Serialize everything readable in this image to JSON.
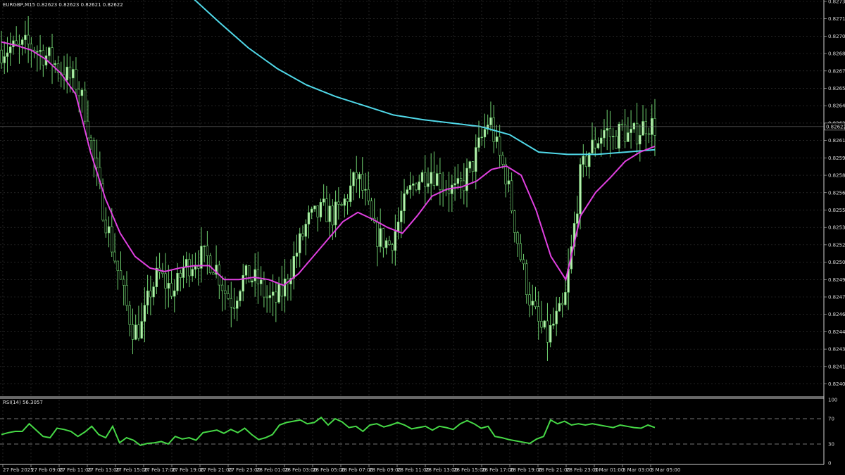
{
  "window": {
    "header": "EURGBP,M15  0.82623 0.82623 0.82621 0.82622",
    "current_price_label": "0.82622"
  },
  "colors": {
    "background": "#000000",
    "grid": "#3a3a3a",
    "bull_candle": "#b8f0b0",
    "wick": "#6fd06f",
    "ma_fast": "#e040e0",
    "ma_slow": "#50d8e8",
    "rsi_line": "#46d846",
    "axis_text": "#d8d8d8"
  },
  "chart_data": [
    {
      "type": "candlestick",
      "title": "EURGBP,M15",
      "symbol": "EURGBP",
      "timeframe": "M15",
      "header_values": [
        "0.82623",
        "0.82623",
        "0.82621",
        "0.82622"
      ],
      "current_price": 0.82622,
      "ylim": [
        0.8239,
        0.8273
      ],
      "y_ticks": [
        "0.82730",
        "0.82715",
        "0.82700",
        "0.82685",
        "0.82670",
        "0.82655",
        "0.82640",
        "0.82625",
        "0.82610",
        "0.82595",
        "0.82580",
        "0.82565",
        "0.82550",
        "0.82535",
        "0.82520",
        "0.82505",
        "0.82490",
        "0.82475",
        "0.82460",
        "0.82445",
        "0.82430",
        "0.82415",
        "0.82400",
        "0.82385"
      ],
      "x_ticks": [
        "27 Feb 2025",
        "27 Feb 09:00",
        "27 Feb 11:00",
        "27 Feb 13:00",
        "27 Feb 15:00",
        "27 Feb 17:00",
        "27 Feb 19:00",
        "27 Feb 21:00",
        "27 Feb 23:00",
        "28 Feb 01:00",
        "28 Feb 03:00",
        "28 Feb 05:00",
        "28 Feb 07:00",
        "28 Feb 09:00",
        "28 Feb 11:00",
        "28 Feb 13:00",
        "28 Feb 15:00",
        "28 Feb 17:00",
        "28 Feb 19:00",
        "28 Feb 21:00",
        "28 Feb 23:00",
        "3 Mar 01:00",
        "3 Mar 03:00",
        "3 Mar 05:00"
      ],
      "grid": true,
      "close_path": [
        0.82688,
        0.8269,
        0.82688,
        0.82692,
        0.8269,
        0.82685,
        0.8268,
        0.82672,
        0.82665,
        0.8266,
        0.8264,
        0.826,
        0.8256,
        0.8253,
        0.825,
        0.8247,
        0.82445,
        0.8245,
        0.8248,
        0.82495,
        0.82485,
        0.8248,
        0.825,
        0.82505,
        0.8251,
        0.82508,
        0.825,
        0.8248,
        0.8247,
        0.8249,
        0.82492,
        0.82488,
        0.82475,
        0.8247,
        0.8248,
        0.825,
        0.8252,
        0.8254,
        0.82545,
        0.8255,
        0.82545,
        0.8255,
        0.82565,
        0.8258,
        0.8256,
        0.8253,
        0.82525,
        0.8252,
        0.8254,
        0.8256,
        0.82575,
        0.8258,
        0.82585,
        0.82575,
        0.8257,
        0.82565,
        0.82575,
        0.8259,
        0.8261,
        0.8263,
        0.826,
        0.8258,
        0.8254,
        0.825,
        0.8247,
        0.8245,
        0.8244,
        0.82455,
        0.82465,
        0.8252,
        0.8258,
        0.826,
        0.8261,
        0.8262,
        0.8261,
        0.8262,
        0.82612,
        0.82618,
        0.82625,
        0.82622
      ],
      "series": [
        {
          "name": "MA fast",
          "color": "#e040e0",
          "values": [
            0.82695,
            0.82692,
            0.82688,
            0.8268,
            0.82668,
            0.8265,
            0.826,
            0.8256,
            0.8253,
            0.8251,
            0.825,
            0.82497,
            0.825,
            0.82502,
            0.82502,
            0.8249,
            0.8249,
            0.82492,
            0.8249,
            0.82485,
            0.82495,
            0.8251,
            0.82525,
            0.8254,
            0.82548,
            0.82542,
            0.82535,
            0.8253,
            0.82545,
            0.82562,
            0.82568,
            0.8257,
            0.82575,
            0.82585,
            0.82588,
            0.8258,
            0.8255,
            0.8251,
            0.8249,
            0.82545,
            0.82565,
            0.82578,
            0.82592,
            0.826,
            0.82605
          ]
        },
        {
          "name": "MA slow",
          "color": "#50d8e8",
          "values": [
            0.82735,
            0.82712,
            0.8269,
            0.82672,
            0.82658,
            0.82648,
            0.8264,
            0.82632,
            0.82628,
            0.82625,
            0.82622,
            0.82615,
            0.826,
            0.82598,
            0.82598,
            0.826,
            0.82602
          ]
        }
      ]
    },
    {
      "type": "line",
      "title": "RSI(14) 56.3057",
      "label": "RSI(14) 56.3057",
      "ylim": [
        0,
        100
      ],
      "y_ticks": [
        "100",
        "70",
        "30",
        "0"
      ],
      "levels": [
        70,
        30
      ],
      "values": [
        45,
        48,
        50,
        50,
        62,
        52,
        42,
        40,
        55,
        53,
        50,
        42,
        49,
        58,
        45,
        40,
        58,
        32,
        40,
        36,
        28,
        31,
        32,
        34,
        30,
        42,
        38,
        40,
        36,
        48,
        50,
        52,
        47,
        53,
        48,
        55,
        45,
        37,
        40,
        45,
        60,
        64,
        66,
        68,
        62,
        64,
        72,
        60,
        70,
        65,
        56,
        58,
        50,
        60,
        62,
        57,
        60,
        64,
        60,
        54,
        56,
        58,
        52,
        58,
        56,
        53,
        62,
        67,
        62,
        55,
        58,
        42,
        40,
        37,
        35,
        33,
        31,
        38,
        42,
        68,
        62,
        66,
        60,
        62,
        60,
        62,
        60,
        58,
        56,
        60,
        58,
        56,
        55,
        60,
        56
      ]
    }
  ]
}
